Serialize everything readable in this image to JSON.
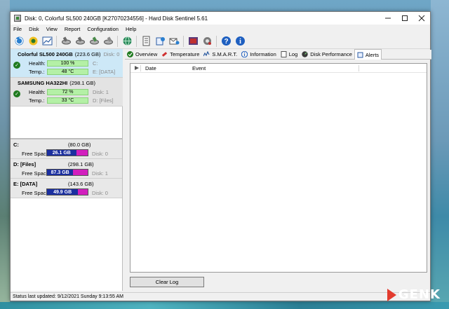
{
  "window": {
    "title": "Disk: 0, Colorful SL500 240GB [K27070234556] - Hard Disk Sentinel 5.61"
  },
  "menu": [
    "File",
    "Disk",
    "View",
    "Report",
    "Configuration",
    "Help"
  ],
  "toolbar": {
    "icons": [
      "refresh-icon",
      "warning-icon",
      "chart-icon",
      "disk-check-icon",
      "disk-test-icon",
      "disk-repair-icon",
      "disk-wipe-icon",
      "globe-icon",
      "report-icon",
      "send-report-icon",
      "alert-mail-icon",
      "tasks-icon",
      "settings-icon",
      "help-icon",
      "info-icon"
    ]
  },
  "disks": [
    {
      "name": "Colorful SL500 240GB",
      "size": "(223.6 GB)",
      "disk": "Disk: 0",
      "health_label": "Health:",
      "health": "100 %",
      "temp_label": "Temp.:",
      "temp": "48 °C",
      "drives": "C:",
      "drives2": "E: [DATA]",
      "selected": true
    },
    {
      "name": "SAMSUNG HA322HI",
      "size": "(298.1 GB)",
      "disk": "Disk: 1",
      "health_label": "Health:",
      "health": "72 %",
      "temp_label": "Temp.:",
      "temp": "33 °C",
      "drives": "D: [Files]",
      "selected": false
    }
  ],
  "volumes": [
    {
      "name": "C:",
      "size": "(80.0 GB)",
      "free_label": "Free Space",
      "free": "26.1 GB",
      "free_fraction": 0.326,
      "disk": "Disk: 0"
    },
    {
      "name": "D: [Files]",
      "size": "(298.1 GB)",
      "free_label": "Free Space",
      "free": "87.3 GB",
      "free_fraction": 0.293,
      "disk": "Disk: 1"
    },
    {
      "name": "E: [DATA]",
      "size": "(143.6 GB)",
      "free_label": "Free Space",
      "free": "49.9 GB",
      "free_fraction": 0.347,
      "disk": "Disk: 0"
    }
  ],
  "tabs": [
    {
      "label": "Overview",
      "icon": "check-icon"
    },
    {
      "label": "Temperature",
      "icon": "thermometer-icon"
    },
    {
      "label": "S.M.A.R.T.",
      "icon": "smart-icon"
    },
    {
      "label": "Information",
      "icon": "info-icon"
    },
    {
      "label": "Log",
      "icon": "log-icon"
    },
    {
      "label": "Disk Performance",
      "icon": "performance-icon"
    },
    {
      "label": "Alerts",
      "icon": "alerts-icon"
    }
  ],
  "active_tab": "Alerts",
  "log": {
    "columns": [
      "Date",
      "Event"
    ],
    "rows": []
  },
  "clear_log_label": "Clear Log",
  "status": "Status last updated: 9/12/2021 Sunday 9:13:55 AM",
  "watermark": "GENK",
  "colors": {
    "health_bar": "#b4f0a6",
    "free_space": "#1b2fa0",
    "used_space": "#d21fbe",
    "selected_disk": "#cde8f7"
  }
}
